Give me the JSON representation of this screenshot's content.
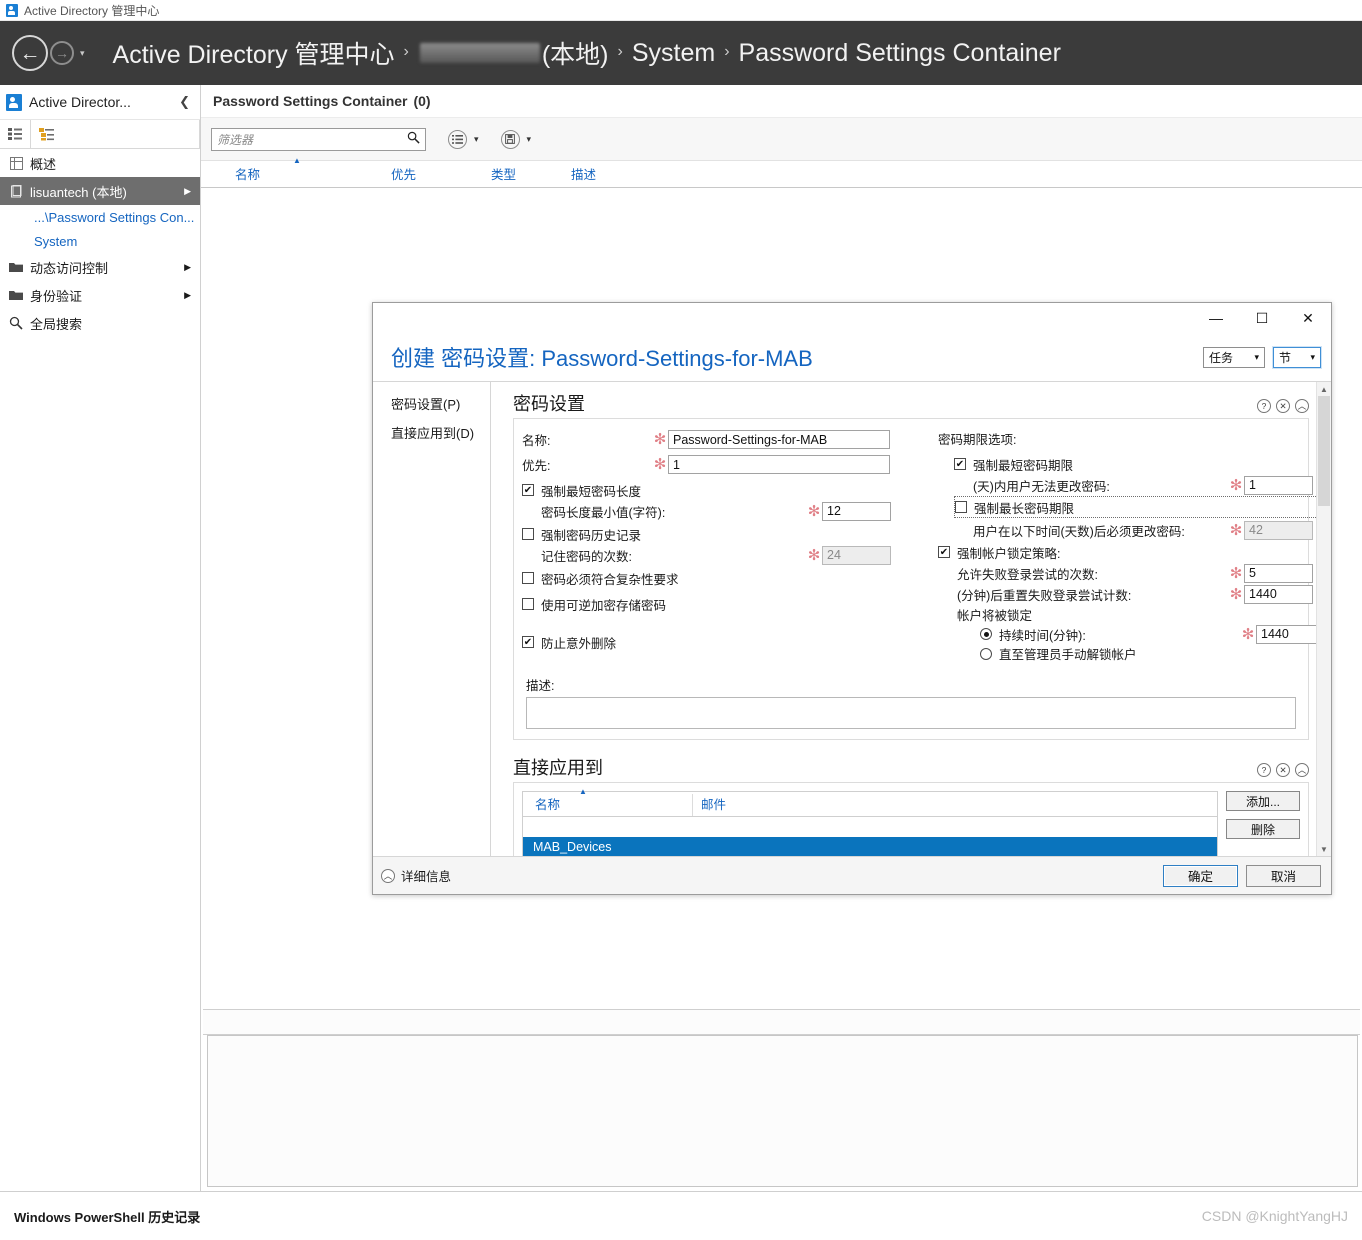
{
  "app": {
    "titlebar_text": "Active Directory 管理中心",
    "titlebar_icon": "active-directory-icon"
  },
  "ribbon": {
    "back_icon": "back-arrow-icon",
    "forward_icon": "forward-arrow-icon",
    "history_caret": "▾",
    "breadcrumb": {
      "root": "Active Directory 管理中心",
      "redacted_domain": "",
      "domain_suffix": "(本地)",
      "node_system": "System",
      "node_leaf": "Password Settings Container",
      "separator": "›"
    }
  },
  "leftnav": {
    "header_title": "Active Director...",
    "collapse_icon": "chevron-left-icon",
    "tabs": [
      {
        "name": "list-view-tab",
        "icon": "list-view-icon"
      },
      {
        "name": "tree-view-tab",
        "icon": "tree-view-icon"
      }
    ],
    "items": [
      {
        "label": "概述",
        "icon": "overview-icon",
        "active": false,
        "expandable": false
      },
      {
        "label": "lisuantech (本地)",
        "icon": "domain-icon",
        "active": true,
        "expandable": true
      },
      {
        "label": "动态访问控制",
        "icon": "folder-icon",
        "active": false,
        "expandable": true
      },
      {
        "label": "身份验证",
        "icon": "folder-icon",
        "active": false,
        "expandable": true
      },
      {
        "label": "全局搜索",
        "icon": "search-icon",
        "active": false,
        "expandable": false
      }
    ],
    "subitems": [
      {
        "label": "...\\Password Settings Con..."
      },
      {
        "label": "System"
      }
    ]
  },
  "main": {
    "header_title": "Password Settings Container",
    "header_count": "(0)",
    "toolbar": {
      "filter_placeholder": "筛选器",
      "filter_value": "",
      "search_icon": "search-icon",
      "view_icon": "list-options-icon",
      "view_caret": "▾",
      "save_icon": "save-query-icon",
      "save_caret": "▾"
    },
    "columns": [
      {
        "label": "名称",
        "sorted": true,
        "sort_mark": "▲"
      },
      {
        "label": "优先",
        "sorted": false
      },
      {
        "label": "类型",
        "sorted": false
      },
      {
        "label": "描述",
        "sorted": false
      }
    ],
    "rows": []
  },
  "statusbar": {
    "powershell_label": "Windows PowerShell 历史记录",
    "watermark": "CSDN @KnightYangHJ"
  },
  "dialog": {
    "window_buttons": {
      "minimize": "—",
      "maximize": "☐",
      "close": "✕"
    },
    "title_prefix": "创建 密码设置",
    "title_sep": ": ",
    "title_value": "Password-Settings-for-MAB",
    "header_buttons": [
      {
        "label": "任务",
        "caret": "▾",
        "focused": false
      },
      {
        "label": "节",
        "caret": "▾",
        "focused": true
      }
    ],
    "sidebar": [
      {
        "label": "密码设置(P)",
        "accel": "P"
      },
      {
        "label": "直接应用到(D)",
        "accel": "D"
      }
    ],
    "section_icons": {
      "help": "?",
      "close": "✕",
      "collapse": "︿"
    },
    "password_section": {
      "heading": "密码设置",
      "name_label": "名称:",
      "name_value": "Password-Settings-for-MAB",
      "precedence_label": "优先:",
      "precedence_value": "1",
      "enforce_min_length": {
        "label": "强制最短密码长度",
        "checked": true
      },
      "min_length_label": "密码长度最小值(字符):",
      "min_length_value": "12",
      "enforce_history": {
        "label": "强制密码历史记录",
        "checked": false
      },
      "history_label": "记住密码的次数:",
      "history_value": "24",
      "history_disabled": true,
      "complexity": {
        "label": "密码必须符合复杂性要求",
        "checked": false
      },
      "reversible": {
        "label": "使用可逆加密存储密码",
        "checked": false
      },
      "protect_delete": {
        "label": "防止意外删除",
        "checked": true
      },
      "age_group_label": "密码期限选项:",
      "enforce_min_age": {
        "label": "强制最短密码期限",
        "checked": true
      },
      "min_age_label": "(天)内用户无法更改密码:",
      "min_age_value": "1",
      "enforce_max_age": {
        "label": "强制最长密码期限",
        "checked": false,
        "focused": true
      },
      "max_age_label": "用户在以下时间(天数)后必须更改密码:",
      "max_age_value": "42",
      "max_age_disabled": true,
      "lockout_policy": {
        "label": "强制帐户锁定策略:",
        "checked": true
      },
      "failed_attempts_label": "允许失败登录尝试的次数:",
      "failed_attempts_value": "5",
      "reset_counter_label": "(分钟)后重置失败登录尝试计数:",
      "reset_counter_value": "1440",
      "lockout_until_label": "帐户将被锁定",
      "duration_radio": {
        "label": "持续时间(分钟):",
        "selected": true
      },
      "duration_value": "1440",
      "manual_radio": {
        "label": "直至管理员手动解锁帐户",
        "selected": false
      },
      "description_label": "描述:",
      "description_value": ""
    },
    "applies_section": {
      "heading": "直接应用到",
      "columns": [
        {
          "label": "名称",
          "sorted": true,
          "sort_mark": "▲"
        },
        {
          "label": "邮件",
          "sorted": false
        }
      ],
      "rows": [
        {
          "name": "MAB_Devices",
          "mail": "",
          "selected": true
        }
      ],
      "add_button": "添加...",
      "remove_button": "删除"
    },
    "footer": {
      "details_label": "详细信息",
      "details_icon": "chevron-up-icon",
      "ok_button": "确定",
      "cancel_button": "取消"
    },
    "accent_selection": "#0a74bd",
    "accent_link": "#1565c0",
    "required_star_color": "#e07f86"
  }
}
